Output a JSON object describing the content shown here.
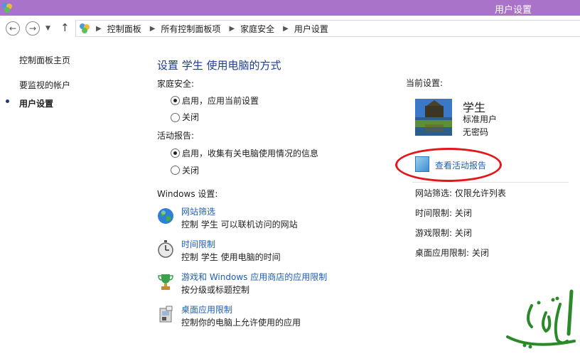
{
  "window": {
    "title": "用户设置"
  },
  "nav": {
    "breadcrumb": [
      "控制面板",
      "所有控制面板项",
      "家庭安全",
      "用户设置"
    ]
  },
  "sidebar": {
    "items": [
      {
        "label": "控制面板主页"
      },
      {
        "label": "要监视的帐户"
      },
      {
        "label": "用户设置"
      }
    ]
  },
  "main": {
    "title": "设置 学生 使用电脑的方式",
    "family_safety": {
      "label": "家庭安全:",
      "options": [
        "启用，应用当前设置",
        "关闭"
      ],
      "selected": 0
    },
    "activity_report": {
      "label": "活动报告:",
      "options": [
        "启用，收集有关电脑使用情况的信息",
        "关闭"
      ],
      "selected": 0
    },
    "windows_settings_label": "Windows 设置:",
    "settings": [
      {
        "icon": "globe-icon",
        "link": "网站筛选",
        "desc": "控制 学生 可以联机访问的网站"
      },
      {
        "icon": "stopwatch-icon",
        "link": "时间限制",
        "desc": "控制 学生 使用电脑的时间"
      },
      {
        "icon": "trophy-icon",
        "link": "游戏和 Windows 应用商店的应用限制",
        "desc": "按分级或标题控制"
      },
      {
        "icon": "desktop-app-icon",
        "link": "桌面应用限制",
        "desc": "控制你的电脑上允许使用的应用"
      }
    ]
  },
  "current": {
    "label": "当前设置:",
    "user_name": "学生",
    "account_type": "标准用户",
    "password": "无密码",
    "report_link": "查看活动报告",
    "status": [
      "网站筛选: 仅限允许列表",
      "时间限制: 关闭",
      "游戏限制: 关闭",
      "桌面应用限制: 关闭"
    ]
  },
  "colors": {
    "titlebar": "#a873c9",
    "link": "#1e5eb5",
    "heading": "#1e3c96",
    "highlight": "#e3171b"
  },
  "watermark": {
    "text": "التوري"
  }
}
